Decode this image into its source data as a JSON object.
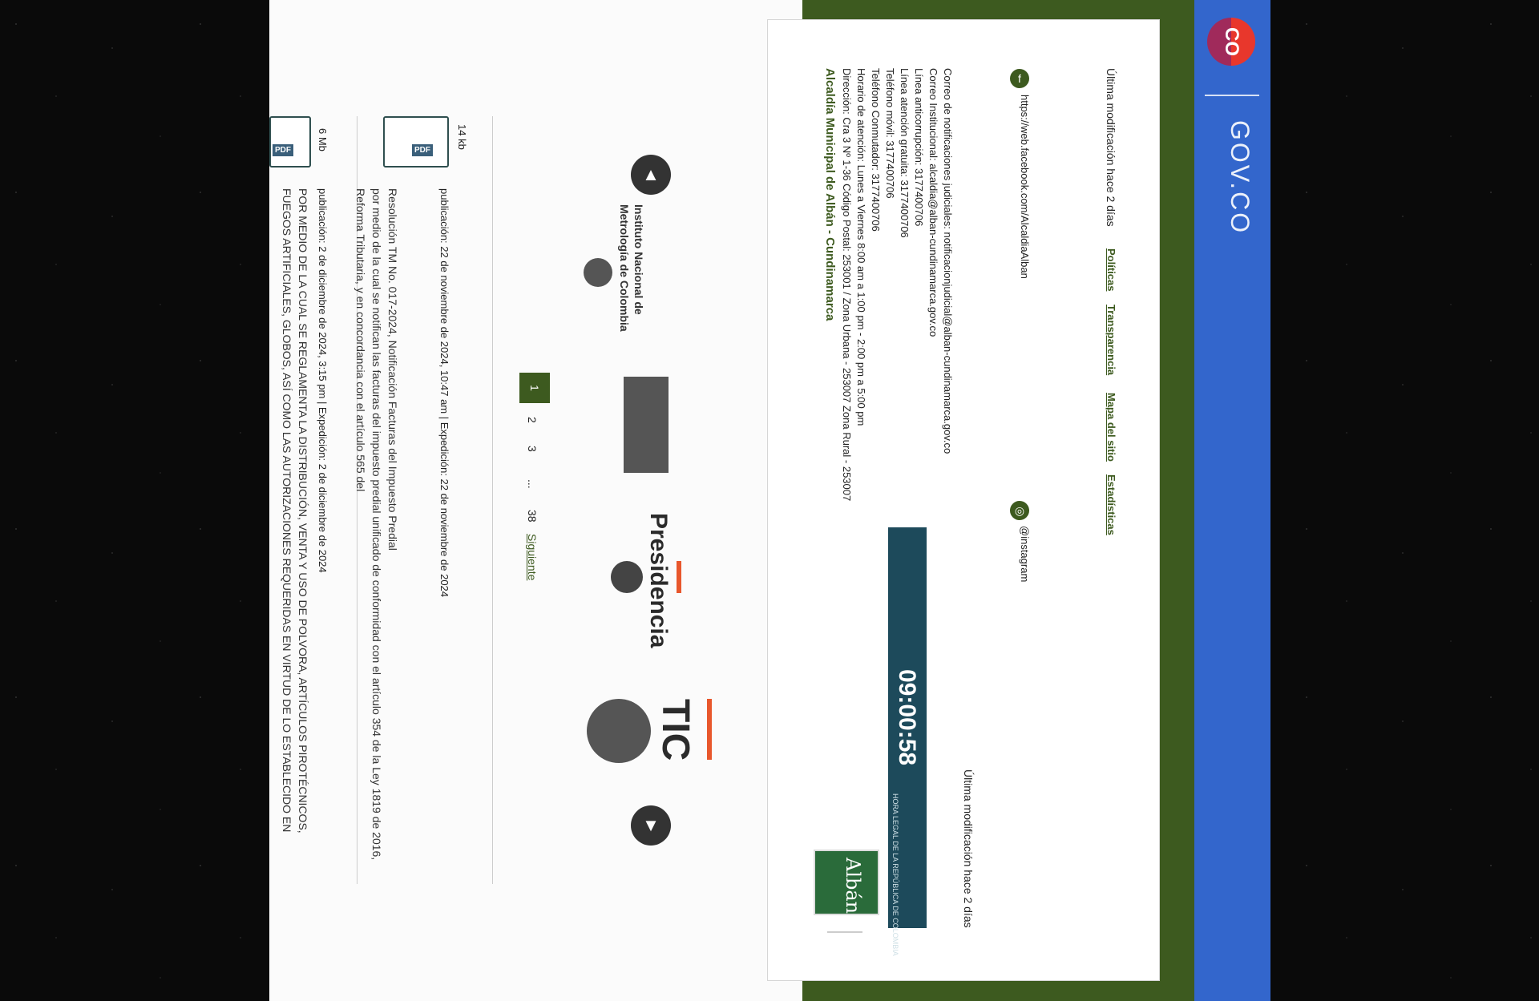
{
  "govco": {
    "logo_text": "CO",
    "brand": "GOV.CO"
  },
  "footer": {
    "last_modified": "Última modificación hace 2 días",
    "links": [
      "Políticas",
      "Transparencia",
      "Mapa del sitio",
      "Estadísticas"
    ],
    "facebook_url": "https://web.facebook.com/AlcaldiaAlban",
    "instagram_label": "@instagram",
    "org_title": "Alcaldía Municipal de Albán - Cundinamarca",
    "address": "Dirección: Cra 3 Nº 1-36 Código Postal: 253001 / Zona Urbana - 253007 Zona Rural - 253007",
    "hours": "Horario de atención: Lunes a Viernes 8:00 am a 1:00 pm - 2:00 pm a 5:00 pm",
    "phone_switch": "Teléfono Conmutador: 3177400706",
    "phone_mobile": "Teléfono móvil: 3177400706",
    "toll_free": "Línea atención gratuita: 3177400706",
    "anticorruption": "Línea anticorrupción: 3177400706",
    "email_institutional": "Correo Institucional: alcaldia@alban-cundinamarca.gov.co",
    "email_notifications": "Correo de notificaciones judiciales: notificacionjudicial@alban-cundinamarca.gov.co",
    "clock_time": "09:00:58",
    "clock_caption": "HORA LEGAL DE LA REPÚBLICA DE COLOMBIA",
    "alban_logo": "Albán"
  },
  "partners": [
    "Instituto Nacional de Metrología de Colombia",
    "Presidencia",
    "TIC"
  ],
  "pagination": {
    "pages": [
      "1",
      "2",
      "3",
      "...",
      "38"
    ],
    "next": "Siguiente",
    "active": "1"
  },
  "documents": [
    {
      "size": "14 kb",
      "tag": "PDF",
      "meta": "publicación: 22 de noviembre de 2024, 10:47 am | Expedición: 22 de noviembre de 2024",
      "title": "Resolución TM No. 017-2024, Notificación Facturas del Impuesto Predial",
      "description": "por medio de la cual se notifican las facturas del impuesto predial unificado de conformidad con el artículo 354 de la Ley 1819 de 2016, Reforma Tributaria, y en concordancia con el artículo 565 del"
    },
    {
      "size": "6 Mb",
      "tag": "PDF",
      "meta": "publicación: 2 de diciembre de 2024, 3:15 pm | Expedición: 2 de diciembre de 2024",
      "title": "POR MEDIO DE LA CUAL SE REGLAMENTA LA DISTRIBUCIÓN, VENTA Y USO DE POLVORA, ARTÍCULOS PIROTÉCNICOS, FUEGOS ARTIFICIALES, GLOBOS, ASÍ COMO LAS AUTORIZACIONES REQUERIDAS EN VIRTUD DE LO ESTABLECIDO EN"
    }
  ]
}
